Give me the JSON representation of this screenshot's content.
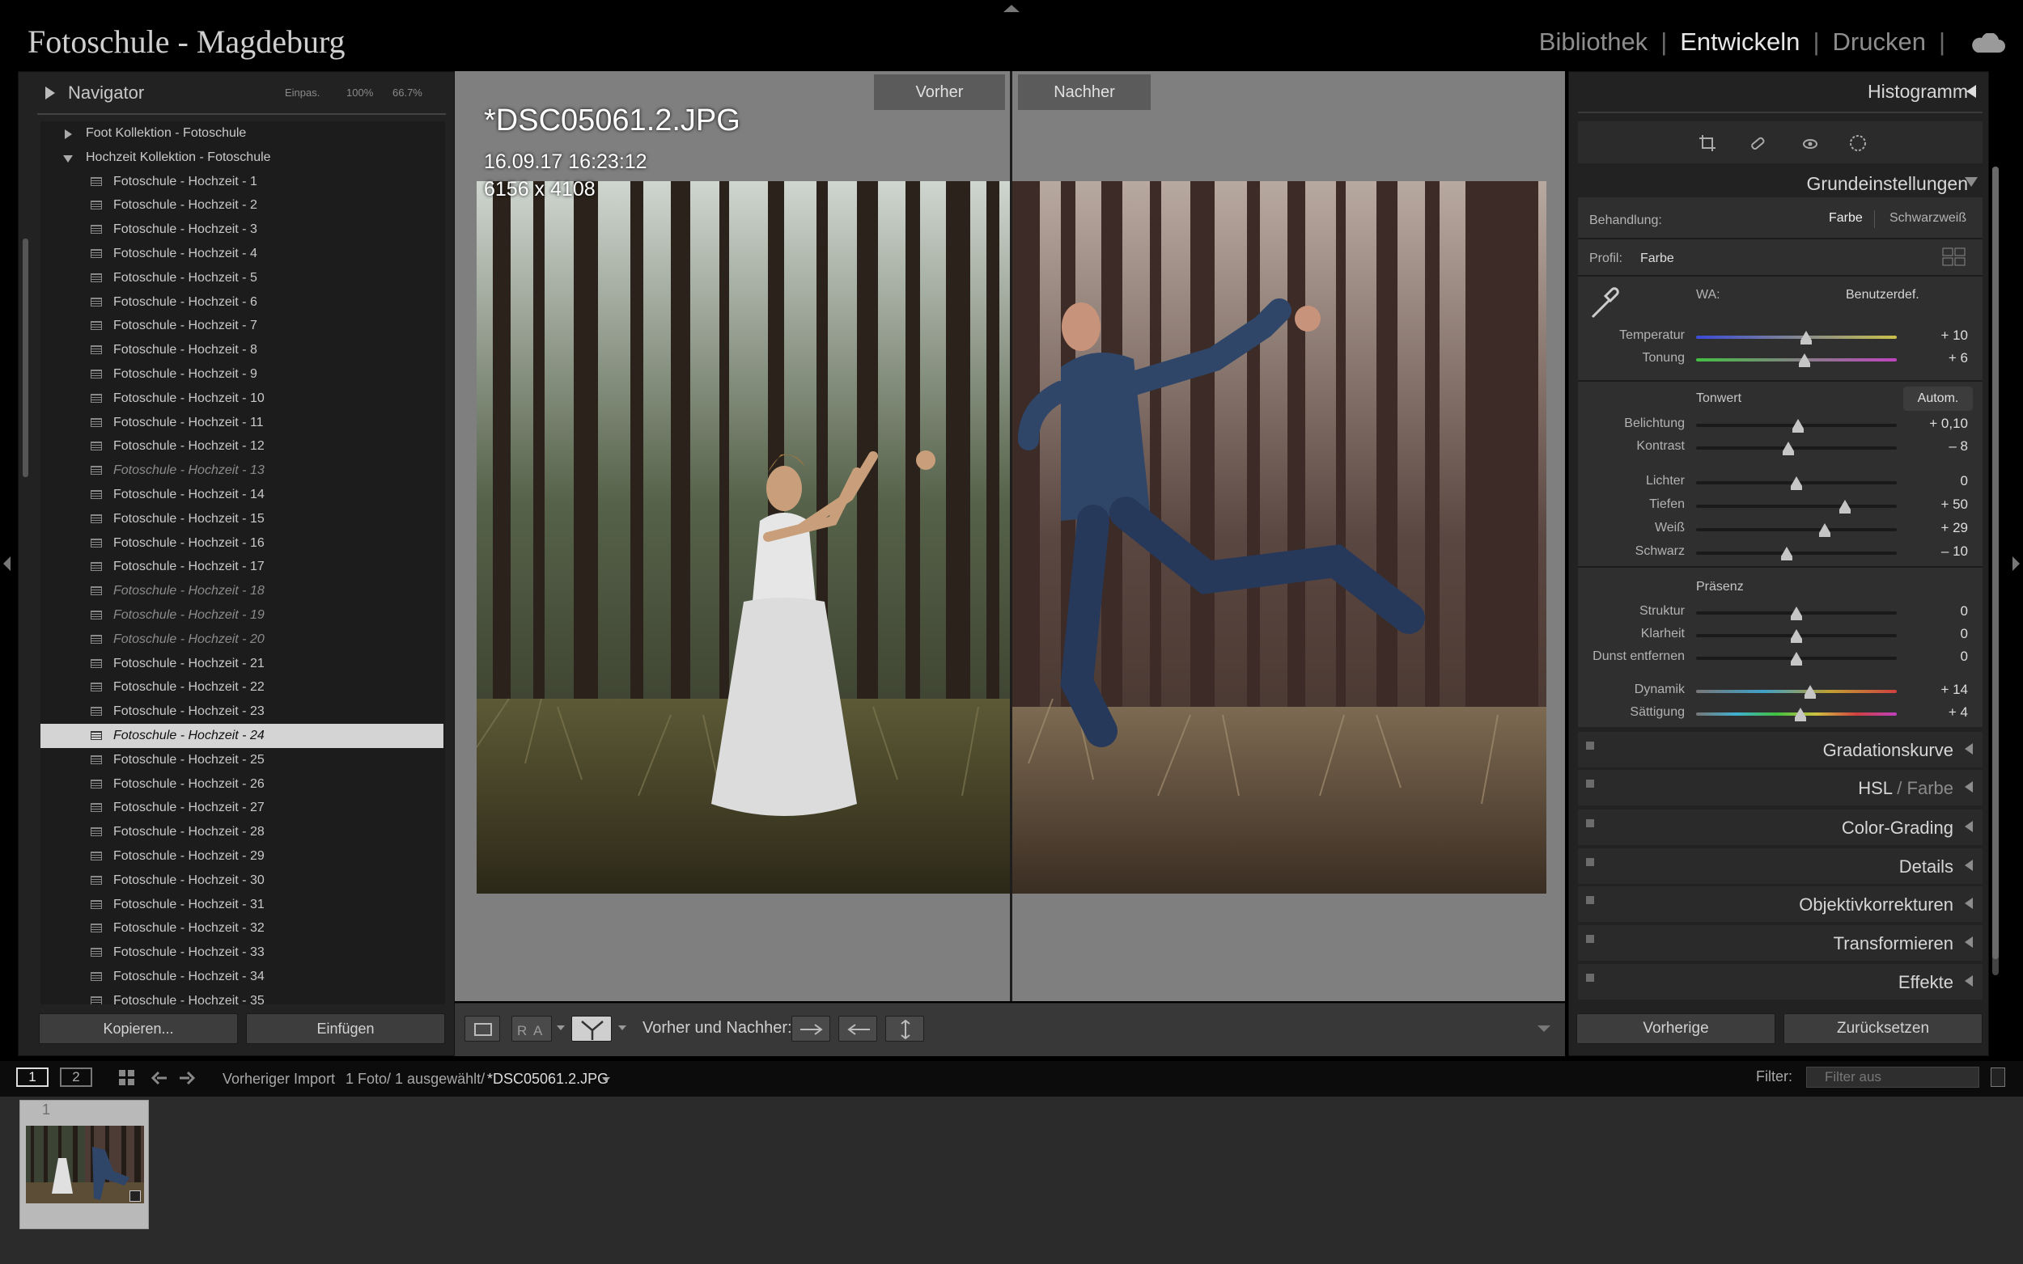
{
  "topbar": {
    "identity_plate": "Fotoschule - Magdeburg",
    "modules": [
      {
        "label": "Bibliothek",
        "active": false
      },
      {
        "label": "Entwickeln",
        "active": true
      },
      {
        "label": "Drucken",
        "active": false
      }
    ]
  },
  "navigator": {
    "title": "Navigator",
    "zoom": [
      "Einpas.",
      "100%",
      "66.7%"
    ]
  },
  "collections": [
    {
      "label": "Foot Kollektion - Fotoschule",
      "type": "folder",
      "expanded": false
    },
    {
      "label": "Hochzeit Kollektion - Fotoschule",
      "type": "folder",
      "expanded": true
    },
    {
      "label": "Fotoschule - Hochzeit - 1",
      "type": "item"
    },
    {
      "label": "Fotoschule - Hochzeit - 2",
      "type": "item"
    },
    {
      "label": "Fotoschule - Hochzeit - 3",
      "type": "item"
    },
    {
      "label": "Fotoschule - Hochzeit - 4",
      "type": "item"
    },
    {
      "label": "Fotoschule - Hochzeit - 5",
      "type": "item"
    },
    {
      "label": "Fotoschule - Hochzeit - 6",
      "type": "item"
    },
    {
      "label": "Fotoschule - Hochzeit - 7",
      "type": "item"
    },
    {
      "label": "Fotoschule - Hochzeit - 8",
      "type": "item"
    },
    {
      "label": "Fotoschule - Hochzeit - 9",
      "type": "item"
    },
    {
      "label": "Fotoschule - Hochzeit - 10",
      "type": "item"
    },
    {
      "label": "Fotoschule - Hochzeit - 11",
      "type": "item"
    },
    {
      "label": "Fotoschule - Hochzeit - 12",
      "type": "item"
    },
    {
      "label": "Fotoschule - Hochzeit - 13",
      "type": "item",
      "dimmed": true
    },
    {
      "label": "Fotoschule - Hochzeit - 14",
      "type": "item"
    },
    {
      "label": "Fotoschule - Hochzeit - 15",
      "type": "item"
    },
    {
      "label": "Fotoschule - Hochzeit - 16",
      "type": "item"
    },
    {
      "label": "Fotoschule - Hochzeit - 17",
      "type": "item"
    },
    {
      "label": "Fotoschule - Hochzeit - 18",
      "type": "item",
      "dimmed": true
    },
    {
      "label": "Fotoschule - Hochzeit - 19",
      "type": "item",
      "dimmed": true
    },
    {
      "label": "Fotoschule - Hochzeit - 20",
      "type": "item",
      "dimmed": true
    },
    {
      "label": "Fotoschule - Hochzeit - 21",
      "type": "item"
    },
    {
      "label": "Fotoschule - Hochzeit - 22",
      "type": "item"
    },
    {
      "label": "Fotoschule - Hochzeit - 23",
      "type": "item"
    },
    {
      "label": "Fotoschule - Hochzeit - 24",
      "type": "item",
      "selected": true
    },
    {
      "label": "Fotoschule - Hochzeit - 25",
      "type": "item"
    },
    {
      "label": "Fotoschule - Hochzeit - 26",
      "type": "item"
    },
    {
      "label": "Fotoschule - Hochzeit - 27",
      "type": "item"
    },
    {
      "label": "Fotoschule - Hochzeit - 28",
      "type": "item"
    },
    {
      "label": "Fotoschule - Hochzeit - 29",
      "type": "item"
    },
    {
      "label": "Fotoschule - Hochzeit - 30",
      "type": "item"
    },
    {
      "label": "Fotoschule - Hochzeit - 31",
      "type": "item"
    },
    {
      "label": "Fotoschule - Hochzeit - 32",
      "type": "item"
    },
    {
      "label": "Fotoschule - Hochzeit - 33",
      "type": "item"
    },
    {
      "label": "Fotoschule - Hochzeit - 34",
      "type": "item"
    },
    {
      "label": "Fotoschule - Hochzeit - 35",
      "type": "item"
    }
  ],
  "left_buttons": {
    "copy": "Kopieren...",
    "paste": "Einfügen"
  },
  "view": {
    "before_label": "Vorher",
    "after_label": "Nachher",
    "filename": "*DSC05061.2.JPG",
    "datetime": "16.09.17 16:23:12",
    "dimensions": "6156 x 4108"
  },
  "toolbar": {
    "mode_label": "Vorher und Nachher:",
    "view_mode_buttons": [
      "loupe",
      "before-after-ra",
      "before-after-split"
    ],
    "copy_buttons": [
      "copy-before-to-after",
      "copy-after-to-before",
      "swap-before-after"
    ]
  },
  "right_panel": {
    "histogram_title": "Histogramm",
    "basic_title": "Grundeinstellungen",
    "treatment_label": "Behandlung:",
    "treatment_options": [
      "Farbe",
      "Schwarzweiß"
    ],
    "treatment_selected": "Farbe",
    "profile_label": "Profil:",
    "profile_value": "Farbe",
    "wb_label": "WA:",
    "wb_value": "Benutzerdef.",
    "tone_label": "Tonwert",
    "auto_label": "Autom.",
    "presence_label": "Präsenz",
    "sliders": [
      {
        "label": "Temperatur",
        "value": "+ 10",
        "pos": 0.55,
        "group": "wb",
        "gradient": "temp"
      },
      {
        "label": "Tonung",
        "value": "+ 6",
        "pos": 0.54,
        "group": "wb",
        "gradient": "tint"
      },
      {
        "label": "Belichtung",
        "value": "+ 0,10",
        "pos": 0.51,
        "group": "tone"
      },
      {
        "label": "Kontrast",
        "value": "– 8",
        "pos": 0.46,
        "group": "tone"
      },
      {
        "label": "Lichter",
        "value": "0",
        "pos": 0.5,
        "group": "tone2"
      },
      {
        "label": "Tiefen",
        "value": "+ 50",
        "pos": 0.74,
        "group": "tone2"
      },
      {
        "label": "Weiß",
        "value": "+ 29",
        "pos": 0.64,
        "group": "tone2"
      },
      {
        "label": "Schwarz",
        "value": "– 10",
        "pos": 0.45,
        "group": "tone2"
      },
      {
        "label": "Struktur",
        "value": "0",
        "pos": 0.5,
        "group": "presence"
      },
      {
        "label": "Klarheit",
        "value": "0",
        "pos": 0.5,
        "group": "presence"
      },
      {
        "label": "Dunst entfernen",
        "value": "0",
        "pos": 0.5,
        "group": "presence"
      },
      {
        "label": "Dynamik",
        "value": "+ 14",
        "pos": 0.57,
        "group": "presence2",
        "gradient": "vib"
      },
      {
        "label": "Sättigung",
        "value": "+ 4",
        "pos": 0.52,
        "group": "presence2",
        "gradient": "sat"
      }
    ],
    "collapsed_panels": [
      {
        "title": "Gradationskurve"
      },
      {
        "title": "HSL",
        "suffix": "Farbe"
      },
      {
        "title": "Color-Grading"
      },
      {
        "title": "Details"
      },
      {
        "title": "Objektivkorrekturen"
      },
      {
        "title": "Transformieren"
      },
      {
        "title": "Effekte"
      }
    ],
    "prev_button": "Vorherige",
    "reset_button": "Zurücksetzen"
  },
  "filmstrip_bar": {
    "screens": [
      "1",
      "2"
    ],
    "source": "Vorheriger Import",
    "count": "1 Foto/ 1 ausgewählt/",
    "current_file": "*DSC05061.2.JPG",
    "filter_label": "Filter:",
    "filter_value": "Filter aus",
    "thumb_number": "1"
  },
  "colors": {
    "accent_panel": "#222222",
    "center_bg": "#7f7f7f",
    "selected_row": "#d4d4d4"
  }
}
